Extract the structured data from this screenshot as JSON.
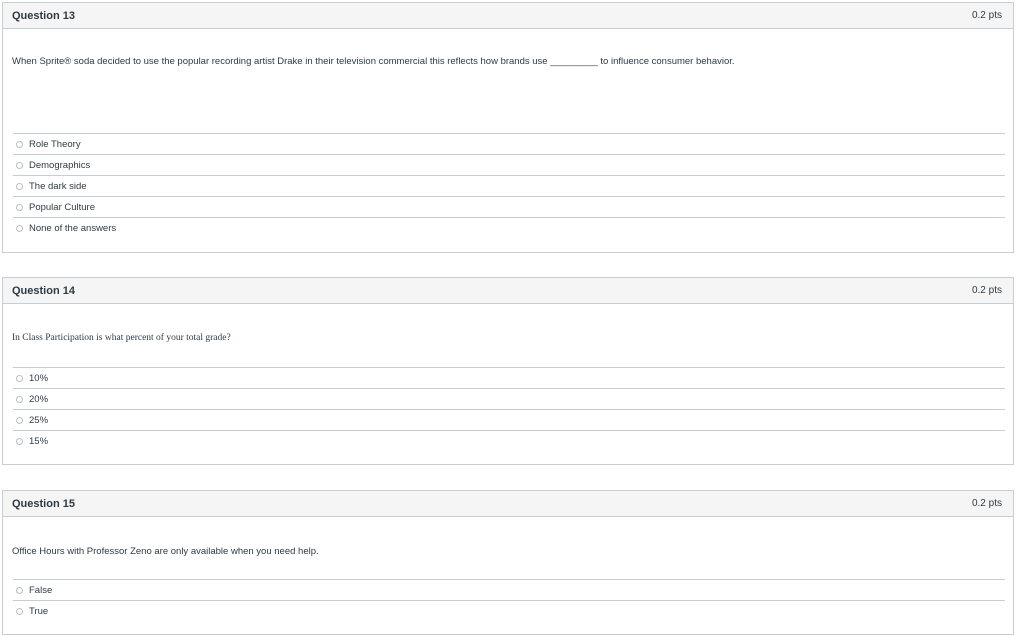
{
  "questions": [
    {
      "title": "Question 13",
      "points": "0.2 pts",
      "text": "When Sprite® soda decided to use the popular recording artist Drake in their television commercial this reflects how brands use _________ to influence consumer behavior.",
      "answers": [
        "Role Theory",
        "Demographics",
        "The dark side",
        "Popular Culture",
        "None of the answers"
      ]
    },
    {
      "title": "Question 14",
      "points": "0.2 pts",
      "text": "In Class Participation is what percent of your total grade?",
      "answers": [
        "10%",
        "20%",
        "25%",
        "15%"
      ]
    },
    {
      "title": "Question 15",
      "points": "0.2 pts",
      "text": "Office Hours with Professor Zeno are only available when you need help.",
      "answers": [
        "False",
        "True"
      ]
    }
  ]
}
